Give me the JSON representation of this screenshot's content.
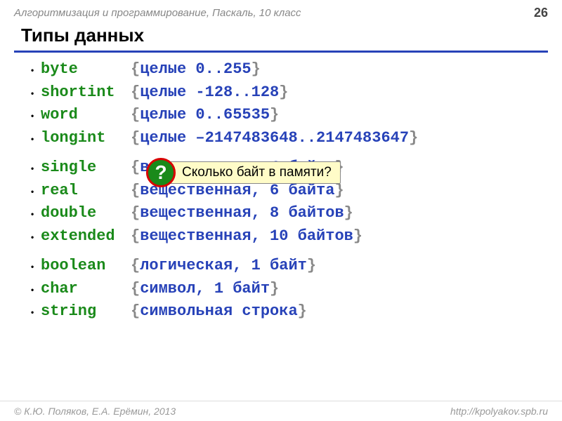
{
  "header": {
    "course": "Алгоритмизация и программирование, Паскаль, 10 класс",
    "page": "26"
  },
  "title": "Типы данных",
  "rows": [
    {
      "kw": "byte",
      "desc": "целые 0..255"
    },
    {
      "kw": "shortint",
      "desc": "целые -128..128"
    },
    {
      "kw": "word",
      "desc": "целые 0..65535"
    },
    {
      "kw": "longint",
      "desc": "целые –2147483648..2147483647"
    },
    {
      "gap": true
    },
    {
      "kw": "single",
      "desc": "вещественная, 4 байта"
    },
    {
      "kw": "real",
      "desc": "вещественная, 6 байта"
    },
    {
      "kw": "double",
      "desc": "вещественная, 8 байтов"
    },
    {
      "kw": "extended",
      "desc": "вещественная, 10 байтов"
    },
    {
      "gap": true
    },
    {
      "kw": "boolean",
      "desc": "логическая, 1 байт"
    },
    {
      "kw": "char",
      "desc": "символ, 1 байт"
    },
    {
      "kw": "string",
      "desc": "символьная строка"
    }
  ],
  "callout": {
    "badge": "?",
    "text": "Сколько байт в памяти?"
  },
  "footer": {
    "copyright": "© К.Ю. Поляков, Е.А. Ерёмин, 2013",
    "url": "http://kpolyakov.spb.ru"
  }
}
